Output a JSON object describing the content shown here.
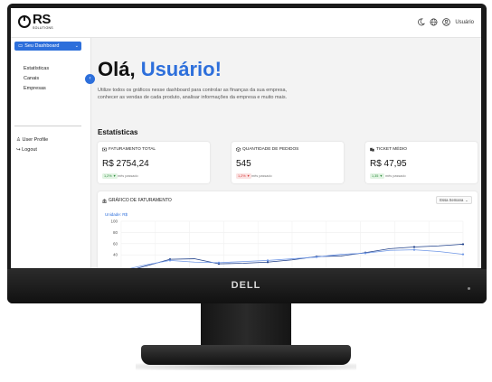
{
  "brand": {
    "logo_main": "RS",
    "logo_sub": "SOLUTIONS"
  },
  "topbar": {
    "user_label": "Usuário",
    "icons": [
      "moon-icon",
      "globe-icon",
      "user-circle-icon"
    ]
  },
  "sidebar": {
    "menu_label": "Seu Dashboard",
    "items": [
      {
        "label": "Estatísticas"
      },
      {
        "label": "Canais"
      },
      {
        "label": "Empresas"
      }
    ],
    "user_profile": "User Profile",
    "logout": "Logout"
  },
  "main": {
    "greeting_prefix": "Olá, ",
    "greeting_name": "Usuário!",
    "intro": "Utilize todos os gráficos nesse dashboard para controlar as finanças da sua empresa, conhecer as vendas de cada produto, analisar informações da empresa e muito mais.",
    "section_title": "Estatísticas"
  },
  "cards": [
    {
      "title": "FATURAMENTO TOTAL",
      "value": "R$ 2754,24",
      "badge": "1,2% ▼",
      "badge_type": "up",
      "note": "mês passado"
    },
    {
      "title": "QUANTIDADE DE PEDIDOS",
      "value": "545",
      "badge": "1,2% ▼",
      "badge_type": "down",
      "note": "mês passado"
    },
    {
      "title": "TICKET MÉDIO",
      "value": "R$ 47,95",
      "badge": "1,35 ▼",
      "badge_type": "up",
      "note": "mês passado"
    }
  ],
  "chart_card": {
    "title": "GRÁFICO DE FATURAMENTO",
    "select_value": "Essa Semana",
    "unit_label": "Unidade: R$"
  },
  "chart_data": {
    "type": "line",
    "yticks": [
      "100",
      "80",
      "60",
      "40"
    ],
    "ylim": [
      0,
      100
    ],
    "series": [
      {
        "values": [
          8,
          20,
          32,
          33,
          24,
          25,
          27,
          31,
          37,
          38,
          44,
          51,
          54,
          56,
          59
        ],
        "color": "#1e3f8a"
      },
      {
        "values": [
          12,
          22,
          30,
          27,
          26,
          28,
          30,
          33,
          36,
          41,
          43,
          48,
          49,
          46,
          41
        ],
        "color": "#6f97e6"
      }
    ],
    "grid": true
  },
  "colors": {
    "accent": "#2d6fdb",
    "badge_up": "#2e8b3e",
    "badge_down": "#d43b3b"
  },
  "monitor": {
    "brand": "DELL"
  }
}
